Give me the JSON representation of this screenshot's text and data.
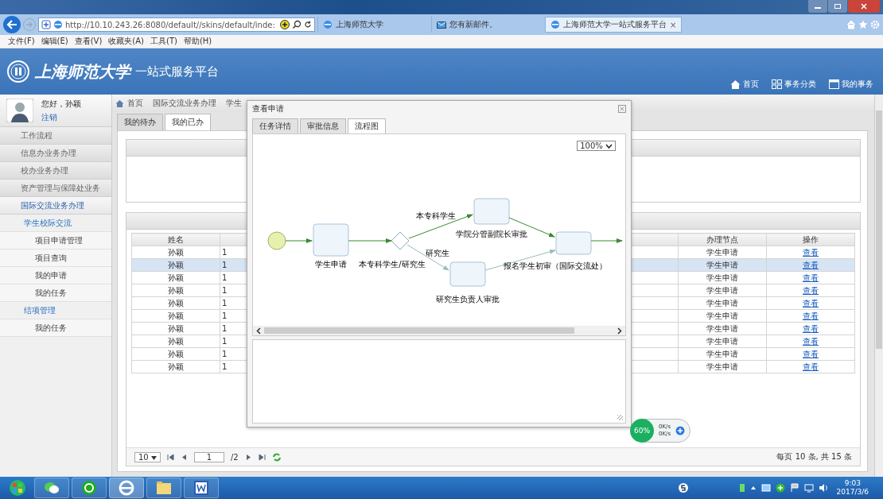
{
  "browser": {
    "address": "http://10.10.243.26:8080/default//skins/default/inde:",
    "tabs": [
      {
        "label": "上海师范大学",
        "kind": "page",
        "selected": false
      },
      {
        "label": "您有新邮件。",
        "kind": "mail",
        "selected": false
      },
      {
        "label": "上海师范大学一站式服务平台",
        "kind": "page",
        "selected": true,
        "close": "×"
      }
    ],
    "menu": [
      "文件(F)",
      "编辑(E)",
      "查看(V)",
      "收藏夹(A)",
      "工具(T)",
      "帮助(H)"
    ]
  },
  "header": {
    "logo": "上海师范大学",
    "subtitle": "一站式服务平台",
    "nav": [
      {
        "label": "首页",
        "kind": "home"
      },
      {
        "label": "事务分类",
        "kind": "grid"
      },
      {
        "label": "我的事务",
        "kind": "window"
      }
    ]
  },
  "user": {
    "greeting": "您好，孙颖",
    "logout": "注销"
  },
  "sidebar": {
    "items": [
      {
        "label": "工作流程",
        "selected": false
      },
      {
        "label": "信息办业务办理",
        "selected": false
      },
      {
        "label": "校办业务办理",
        "selected": false
      },
      {
        "label": "资产管理与保障处业务",
        "selected": false
      },
      {
        "label": "国际交流业务办理",
        "selected": true,
        "children": [
          {
            "label": "学生校际交流",
            "children": [
              {
                "label": "项目申请管理"
              },
              {
                "label": "项目查询"
              },
              {
                "label": "我的申请"
              },
              {
                "label": "我的任务"
              }
            ]
          },
          {
            "label": "结项管理",
            "children": [
              {
                "label": "我的任务"
              }
            ]
          }
        ]
      }
    ]
  },
  "breadcrumb": [
    "首页",
    "国际交流业务办理",
    "学生"
  ],
  "tabs": [
    {
      "label": "我的待办",
      "selected": false
    },
    {
      "label": "我的已办",
      "selected": true
    }
  ],
  "table": {
    "columns": [
      "姓名",
      "办理节点",
      "操作"
    ],
    "rows": [
      {
        "name": "孙颖",
        "column_2": "1",
        "node": "学生申请",
        "action": "查看",
        "selected": false
      },
      {
        "name": "孙颖",
        "column_2": "1",
        "node": "学生申请",
        "action": "查看",
        "selected": true
      },
      {
        "name": "孙颖",
        "column_2": "1",
        "node": "学生申请",
        "action": "查看",
        "selected": false
      },
      {
        "name": "孙颖",
        "column_2": "1",
        "node": "学生申请",
        "action": "查看",
        "selected": false
      },
      {
        "name": "孙颖",
        "column_2": "1",
        "node": "学生申请",
        "action": "查看",
        "selected": false
      },
      {
        "name": "孙颖",
        "column_2": "1",
        "node": "学生申请",
        "action": "查看",
        "selected": false
      },
      {
        "name": "孙颖",
        "column_2": "1",
        "node": "学生申请",
        "action": "查看",
        "selected": false
      },
      {
        "name": "孙颖",
        "column_2": "1",
        "node": "学生申请",
        "action": "查看",
        "selected": false
      },
      {
        "name": "孙颖",
        "column_2": "1",
        "node": "学生申请",
        "action": "查看",
        "selected": false
      },
      {
        "name": "孙颖",
        "column_2": "1",
        "node": "学生申请",
        "action": "查看",
        "selected": false
      }
    ]
  },
  "pager": {
    "page_size": "10",
    "page": "1",
    "total_pages": "/2",
    "summary": "每页 10 条, 共 15 条"
  },
  "dialog": {
    "title": "查看申请",
    "tabs": [
      {
        "label": "任务详情",
        "selected": false
      },
      {
        "label": "审批信息",
        "selected": false
      },
      {
        "label": "流程图",
        "selected": true
      }
    ],
    "zoom": "100%",
    "nodes": [
      "学生申请",
      "学院分管副院长审批",
      "研究生负责人审批",
      "报名学生初审（国际交流处）"
    ],
    "edge_labels": [
      "本专科学生",
      "研究生",
      "本专科学生/研究生"
    ]
  },
  "network_widget": {
    "percent": "60%",
    "upload": "0K/s",
    "download": "0K/s"
  },
  "taskbar": {
    "time": "9:03",
    "date": "2017/3/6"
  }
}
